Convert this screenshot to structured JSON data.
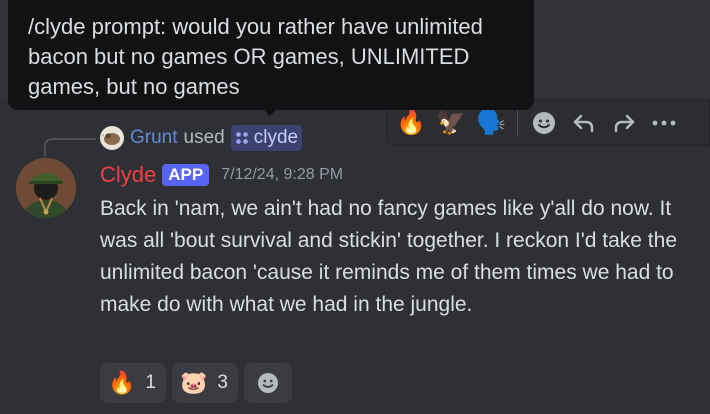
{
  "tooltip": {
    "text": "/clyde prompt: would you rather have unlimited bacon but no games OR games, UNLIMITED games, but no games"
  },
  "command": {
    "user": "Grunt",
    "verb": "used",
    "name": "clyde"
  },
  "message": {
    "author": "Clyde",
    "badge": "APP",
    "timestamp": "7/12/24, 9:28 PM",
    "text": "Back in 'nam, we ain't had no fancy games like y'all do now. It was all 'bout survival and stickin' together. I reckon I'd take the unlimited bacon 'cause it reminds me of them times we had to make do with what we had in the jungle."
  },
  "reactions": [
    {
      "emoji": "🔥",
      "count": "1",
      "icon": "fire-emoji"
    },
    {
      "emoji": "🐷",
      "count": "3",
      "icon": "pig-emoji"
    }
  ],
  "toolbar": {
    "quick_reactions": [
      "🔥",
      "🦅",
      "🗣️"
    ],
    "icons": [
      "add-reaction-icon",
      "reply-icon",
      "forward-icon",
      "more-icon"
    ]
  },
  "colors": {
    "background": "#313338",
    "author": "#f23f43",
    "app_badge": "#5865f2",
    "command_user": "#5d8bd6"
  }
}
